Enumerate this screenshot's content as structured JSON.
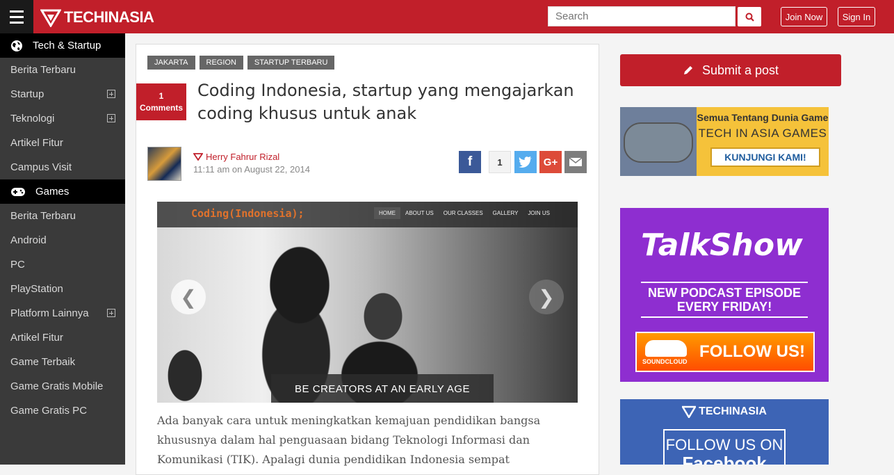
{
  "header": {
    "logo_text": "TECHINASIA",
    "search_placeholder": "Search",
    "join_label": "Join Now",
    "signin_label": "Sign In"
  },
  "sidebar": {
    "sections": [
      {
        "title": "Tech & Startup",
        "icon": "globe-icon",
        "items": [
          {
            "label": "Berita Terbaru",
            "expandable": false
          },
          {
            "label": "Startup",
            "expandable": true
          },
          {
            "label": "Teknologi",
            "expandable": true
          },
          {
            "label": "Artikel Fitur",
            "expandable": false
          },
          {
            "label": "Campus Visit",
            "expandable": false
          }
        ]
      },
      {
        "title": "Games",
        "icon": "gamepad-icon",
        "items": [
          {
            "label": "Berita Terbaru",
            "expandable": false
          },
          {
            "label": "Android",
            "expandable": false
          },
          {
            "label": "PC",
            "expandable": false
          },
          {
            "label": "PlayStation",
            "expandable": false
          },
          {
            "label": "Platform Lainnya",
            "expandable": true
          },
          {
            "label": "Artikel Fitur",
            "expandable": false
          },
          {
            "label": "Game Terbaik",
            "expandable": false
          },
          {
            "label": "Game Gratis Mobile",
            "expandable": false
          },
          {
            "label": "Game Gratis PC",
            "expandable": false
          }
        ]
      }
    ]
  },
  "article": {
    "tags": [
      "JAKARTA",
      "REGION",
      "STARTUP TERBARU"
    ],
    "comments_count": "1",
    "comments_label": "Comments",
    "title": "Coding Indonesia, startup yang mengajarkan coding khusus untuk anak",
    "author": "Herry Fahrur Rizal",
    "date": "11:11 am on August 22, 2014",
    "share_count": "1",
    "slide": {
      "site_logo": "Coding(Indonesia);",
      "nav": [
        "HOME",
        "ABOUT US",
        "OUR CLASSES",
        "GALLERY",
        "JOIN US"
      ],
      "caption": "BE CREATORS AT AN EARLY AGE"
    },
    "body": "Ada banyak cara untuk meningkatkan kemajuan pendidikan bangsa khususnya dalam hal penguasaan bidang Teknologi Informasi dan Komunikasi (TIK). Apalagi dunia pendidikan Indonesia sempat"
  },
  "right": {
    "submit_label": "Submit a post",
    "ad_games": {
      "line1": "Semua Tentang Dunia Game",
      "line2": "TECH IN ASIA GAMES",
      "cta": "KUNJUNGI KAMI!"
    },
    "ad_talkshow": {
      "title": "TalkShow",
      "line1": "NEW PODCAST EPISODE",
      "line2": "EVERY FRIDAY!",
      "brand": "SOUNDCLOUD",
      "cta": "FOLLOW US!"
    },
    "ad_facebook": {
      "logo": "TECHINASIA",
      "line1": "FOLLOW US ON",
      "line2": "Facebook"
    }
  }
}
